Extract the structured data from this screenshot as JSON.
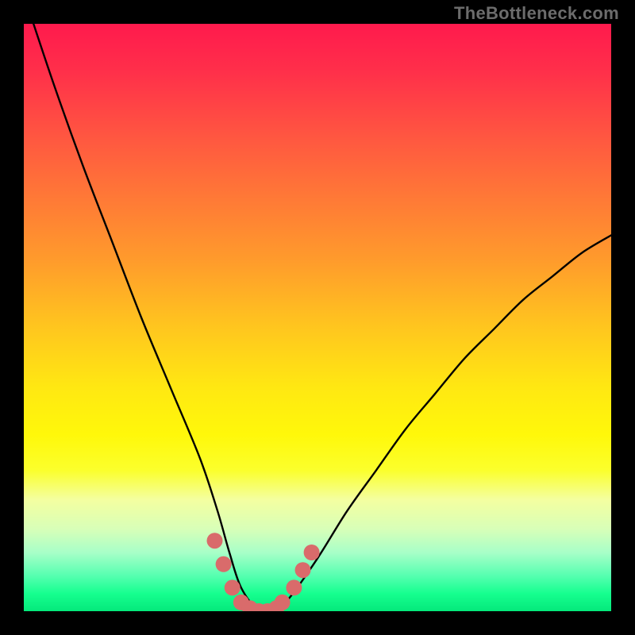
{
  "watermark": "TheBottleneck.com",
  "chart_data": {
    "type": "line",
    "title": "",
    "xlabel": "",
    "ylabel": "",
    "xlim": [
      0,
      100
    ],
    "ylim": [
      0,
      100
    ],
    "series": [
      {
        "name": "bottleneck-curve",
        "x": [
          0,
          5,
          10,
          15,
          20,
          25,
          30,
          33,
          35,
          37,
          40,
          42.5,
          45,
          50,
          55,
          60,
          65,
          70,
          75,
          80,
          85,
          90,
          95,
          100
        ],
        "y": [
          105,
          90,
          76,
          63,
          50,
          38,
          26,
          17,
          10,
          4,
          0,
          0,
          2,
          9,
          17,
          24,
          31,
          37,
          43,
          48,
          53,
          57,
          61,
          64
        ]
      }
    ],
    "markers": {
      "name": "highlight-points",
      "color": "#d96b6b",
      "points": [
        {
          "x": 32.5,
          "y": 12
        },
        {
          "x": 34.0,
          "y": 8
        },
        {
          "x": 35.5,
          "y": 4
        },
        {
          "x": 37.0,
          "y": 1.5
        },
        {
          "x": 38.5,
          "y": 0.5
        },
        {
          "x": 40.0,
          "y": 0
        },
        {
          "x": 41.5,
          "y": 0
        },
        {
          "x": 43.0,
          "y": 0.5
        },
        {
          "x": 44.0,
          "y": 1.5
        },
        {
          "x": 46.0,
          "y": 4
        },
        {
          "x": 47.5,
          "y": 7
        },
        {
          "x": 49.0,
          "y": 10
        }
      ]
    },
    "background": "rainbow-gradient-vertical"
  }
}
